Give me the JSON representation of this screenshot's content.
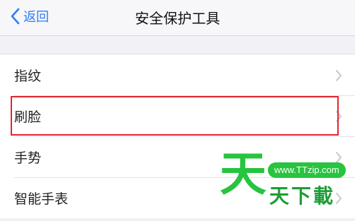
{
  "navbar": {
    "back_label": "返回",
    "title": "安全保护工具"
  },
  "list": {
    "items": [
      {
        "label": "指纹"
      },
      {
        "label": "刷脸"
      },
      {
        "label": "手势"
      },
      {
        "label": "智能手表"
      }
    ]
  },
  "watermark": {
    "big_char": "天",
    "url": "www.TTzip.com",
    "name": "天下載"
  },
  "colors": {
    "accent": "#2f7bf6",
    "highlight": "#e0262f",
    "watermark_green": "#27c43f"
  },
  "icons": {
    "back": "chevron-left-icon",
    "row": "chevron-right-icon"
  }
}
